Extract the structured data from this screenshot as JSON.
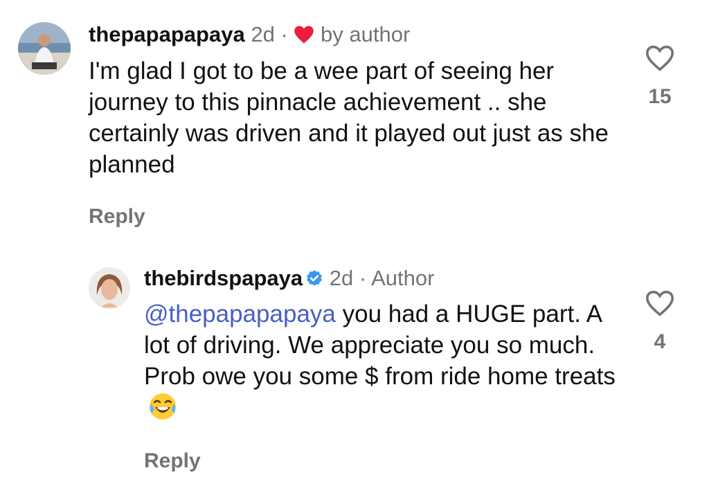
{
  "comments": [
    {
      "username": "thepapapapaya",
      "time": "2d",
      "separator": "·",
      "liked_by_author_label": "by author",
      "text": "I'm glad I got to be a wee part of seeing her journey to this pinnacle achievement .. she certainly was driven and it played out just as she planned",
      "reply_label": "Reply",
      "likes": "15"
    },
    {
      "username": "thebirdspapaya",
      "time": "2d",
      "separator": "·",
      "author_badge": "Author",
      "mention": "@thepapapapaya",
      "text": "you had a HUGE part. A lot of driving. We appreciate you so much. Prob owe you some $ from ride home treats",
      "emoji": "tears-of-joy",
      "reply_label": "Reply",
      "likes": "4"
    }
  ],
  "colors": {
    "text": "#111111",
    "muted": "#737373",
    "mention": "#4a5fc1",
    "heart_red": "#ed1c3b",
    "verified_blue": "#3897f0"
  }
}
